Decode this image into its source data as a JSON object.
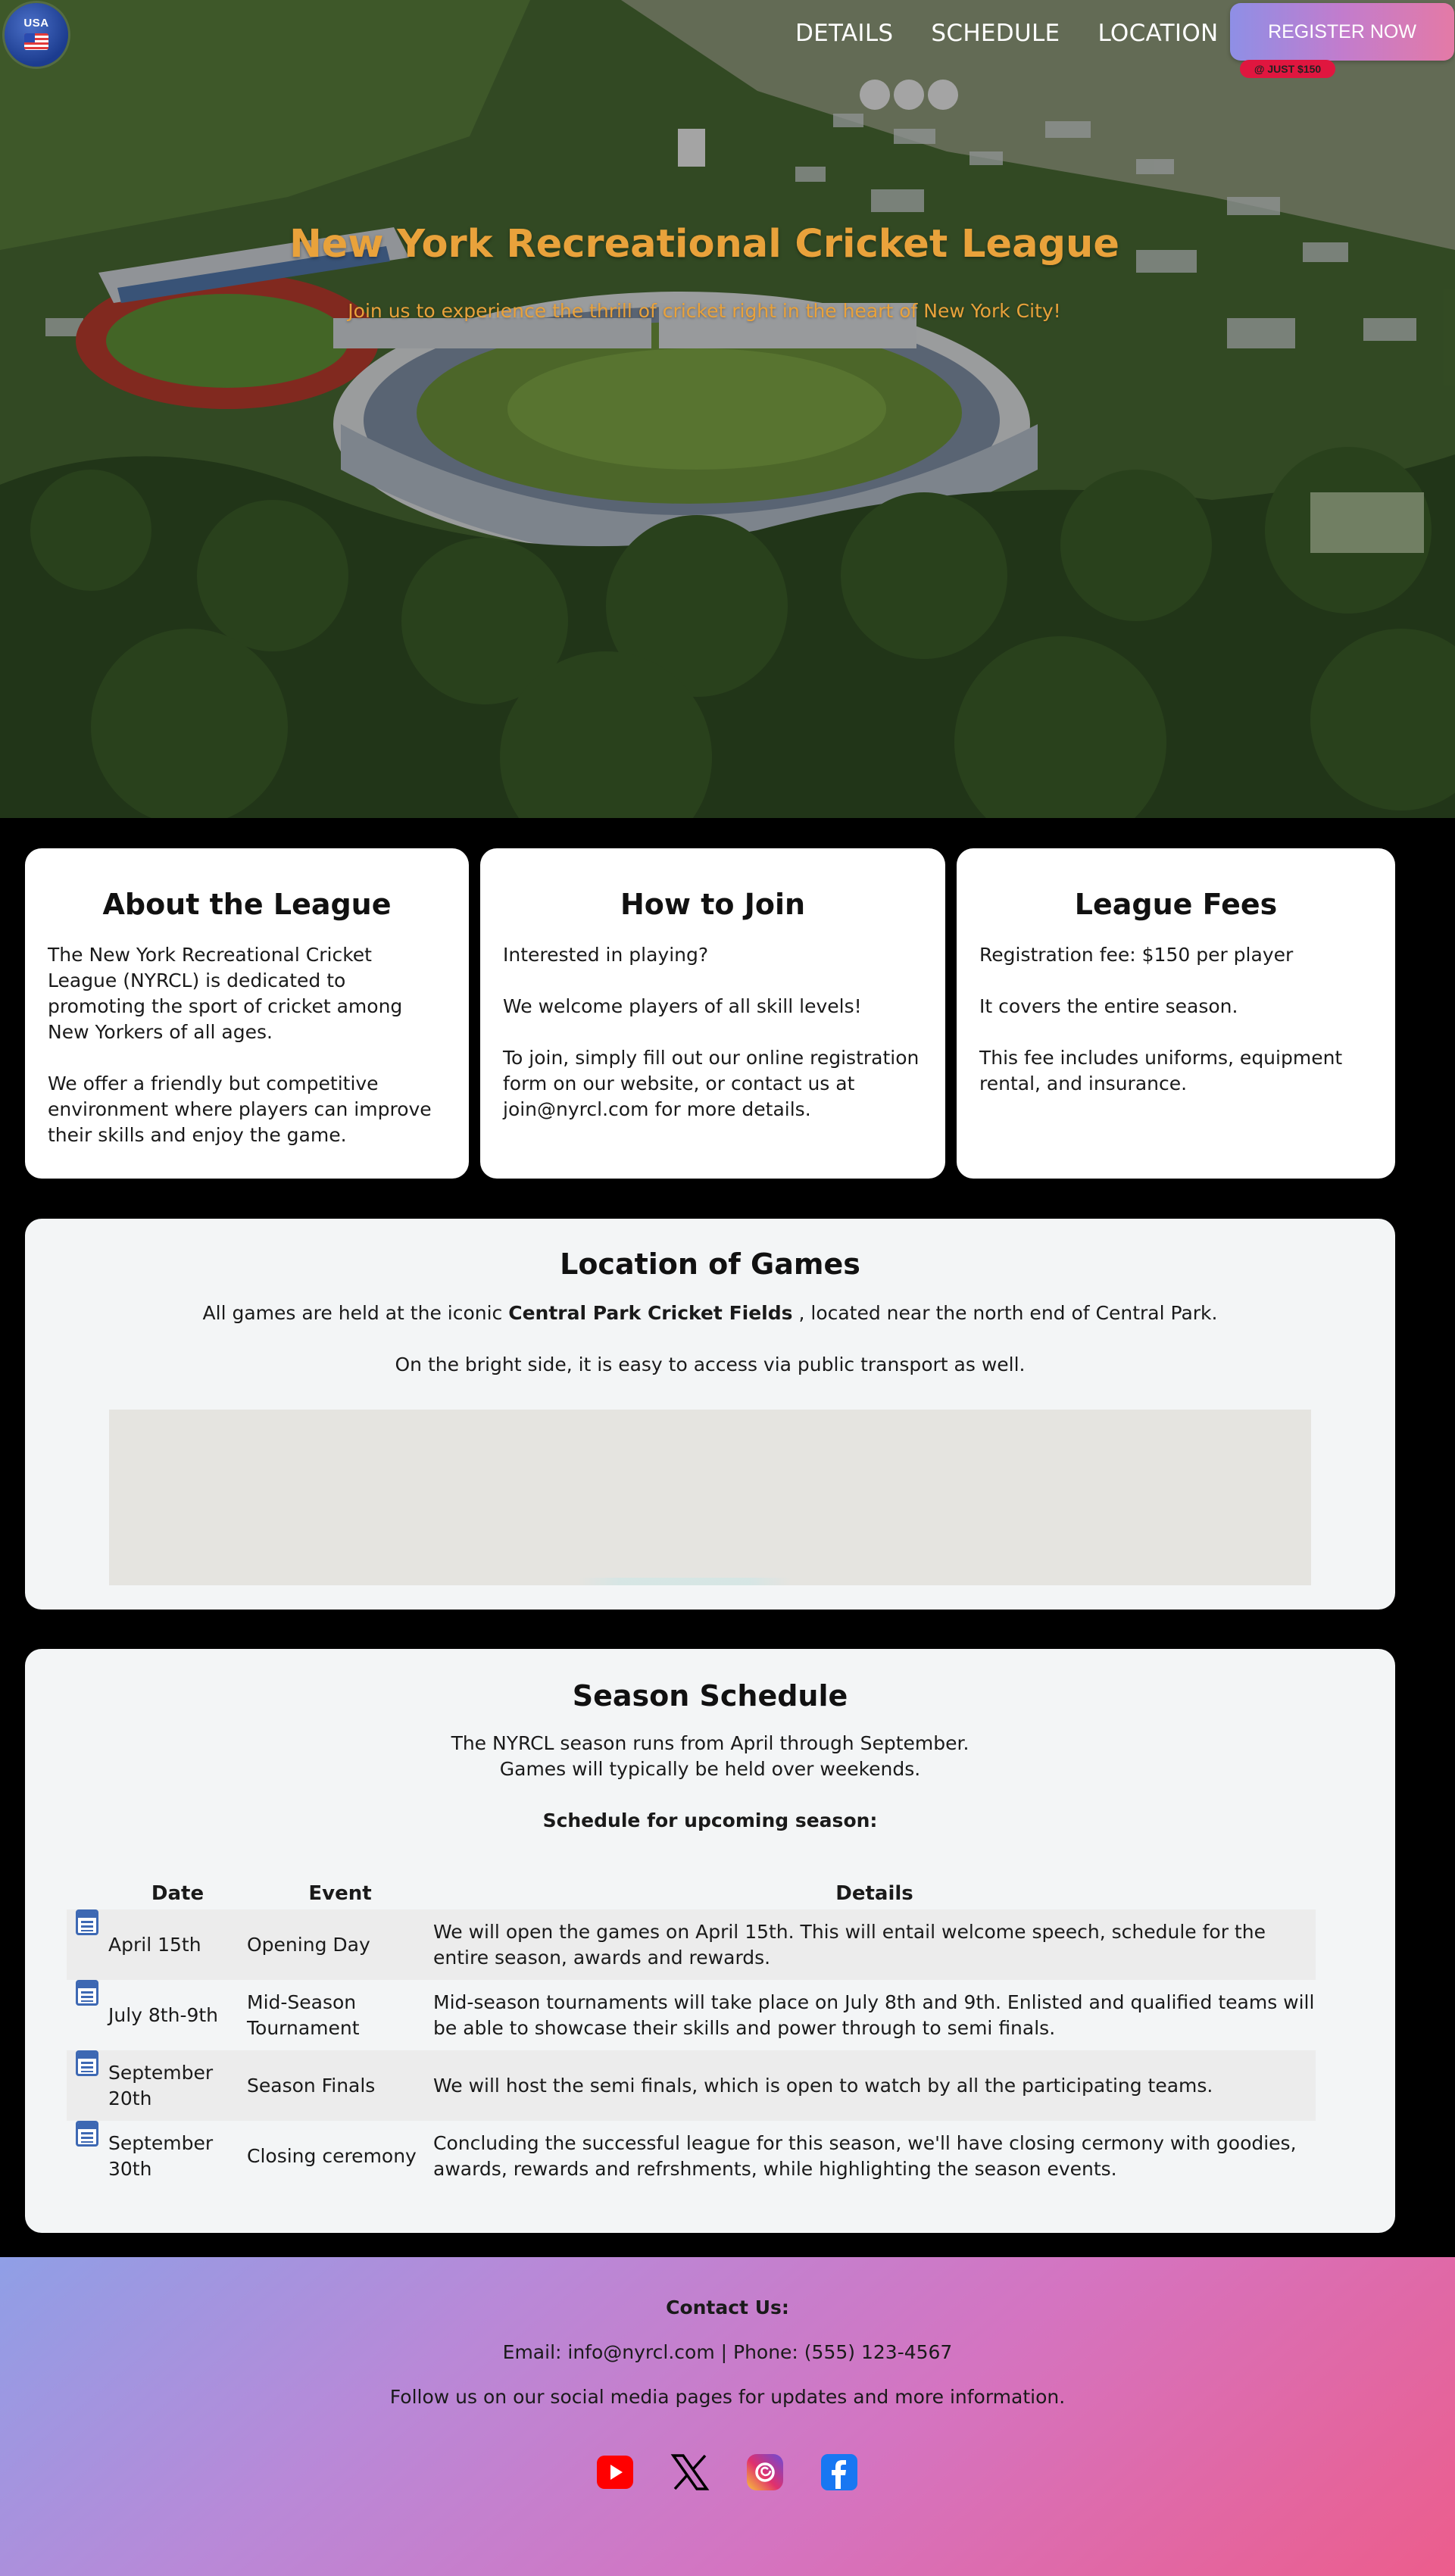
{
  "logo": {
    "text": "USA"
  },
  "nav": {
    "items": [
      "DETAILS",
      "SCHEDULE",
      "LOCATION"
    ],
    "register_label": "REGISTER NOW",
    "badge": "@ JUST $150"
  },
  "hero": {
    "title": "New York Recreational Cricket League",
    "subtitle": "Join us to experience the thrill of cricket right in the heart of New York City!"
  },
  "cards": [
    {
      "title": "About the League",
      "paragraphs": [
        "The New York Recreational Cricket League (NYRCL) is dedicated to promoting the sport of cricket among New Yorkers of all ages.",
        "We offer a friendly but competitive environment where players can improve their skills and enjoy the game."
      ]
    },
    {
      "title": "How to Join",
      "paragraphs": [
        "Interested in playing?",
        "We welcome players of all skill levels!",
        "To join, simply fill out our online registration form on our website, or contact us at join@nyrcl.com for more details."
      ]
    },
    {
      "title": "League Fees",
      "paragraphs": [
        "Registration fee: $150 per player",
        "It covers the entire season.",
        "This fee includes uniforms, equipment rental, and insurance."
      ]
    }
  ],
  "location": {
    "title": "Location of Games",
    "line1_before": "All games are held at the iconic ",
    "line1_bold": "Central Park Cricket Fields",
    "line1_after": " , located near the north end of Central Park.",
    "line2": "On the bright side, it is easy to access via public transport as well."
  },
  "schedule": {
    "title": "Season Schedule",
    "intro1": "The NYRCL season runs from April through September.",
    "intro2": "Games will typically be held over weekends.",
    "subheading": "Schedule for upcoming season:",
    "columns": [
      "Date",
      "Event",
      "Details"
    ],
    "rows": [
      {
        "date": "April 15th",
        "event": "Opening Day",
        "details": "We will open the games on April 15th. This will entail welcome speech, schedule for the entire season, awards and rewards."
      },
      {
        "date": "July 8th-9th",
        "event": "Mid-Season Tournament",
        "details": "Mid-season tournaments will take place on July 8th and 9th. Enlisted and qualified teams will be able to showcase their skills and power through to semi finals."
      },
      {
        "date": "September 20th",
        "event": "Season Finals",
        "details": "We will host the semi finals, which is open to watch by all the participating teams."
      },
      {
        "date": "September 30th",
        "event": "Closing ceremony",
        "details": "Concluding the successful league for this season, we'll have closing cermony with goodies, awards, rewards and refrshments, while highlighting the season events."
      }
    ]
  },
  "footer": {
    "heading": "Contact Us:",
    "contact": "Email: info@nyrcl.com | Phone: (555) 123-4567",
    "follow": "Follow us on our social media pages for updates and more information.",
    "social": [
      "youtube-icon",
      "x-icon",
      "threads-icon",
      "facebook-icon"
    ]
  }
}
